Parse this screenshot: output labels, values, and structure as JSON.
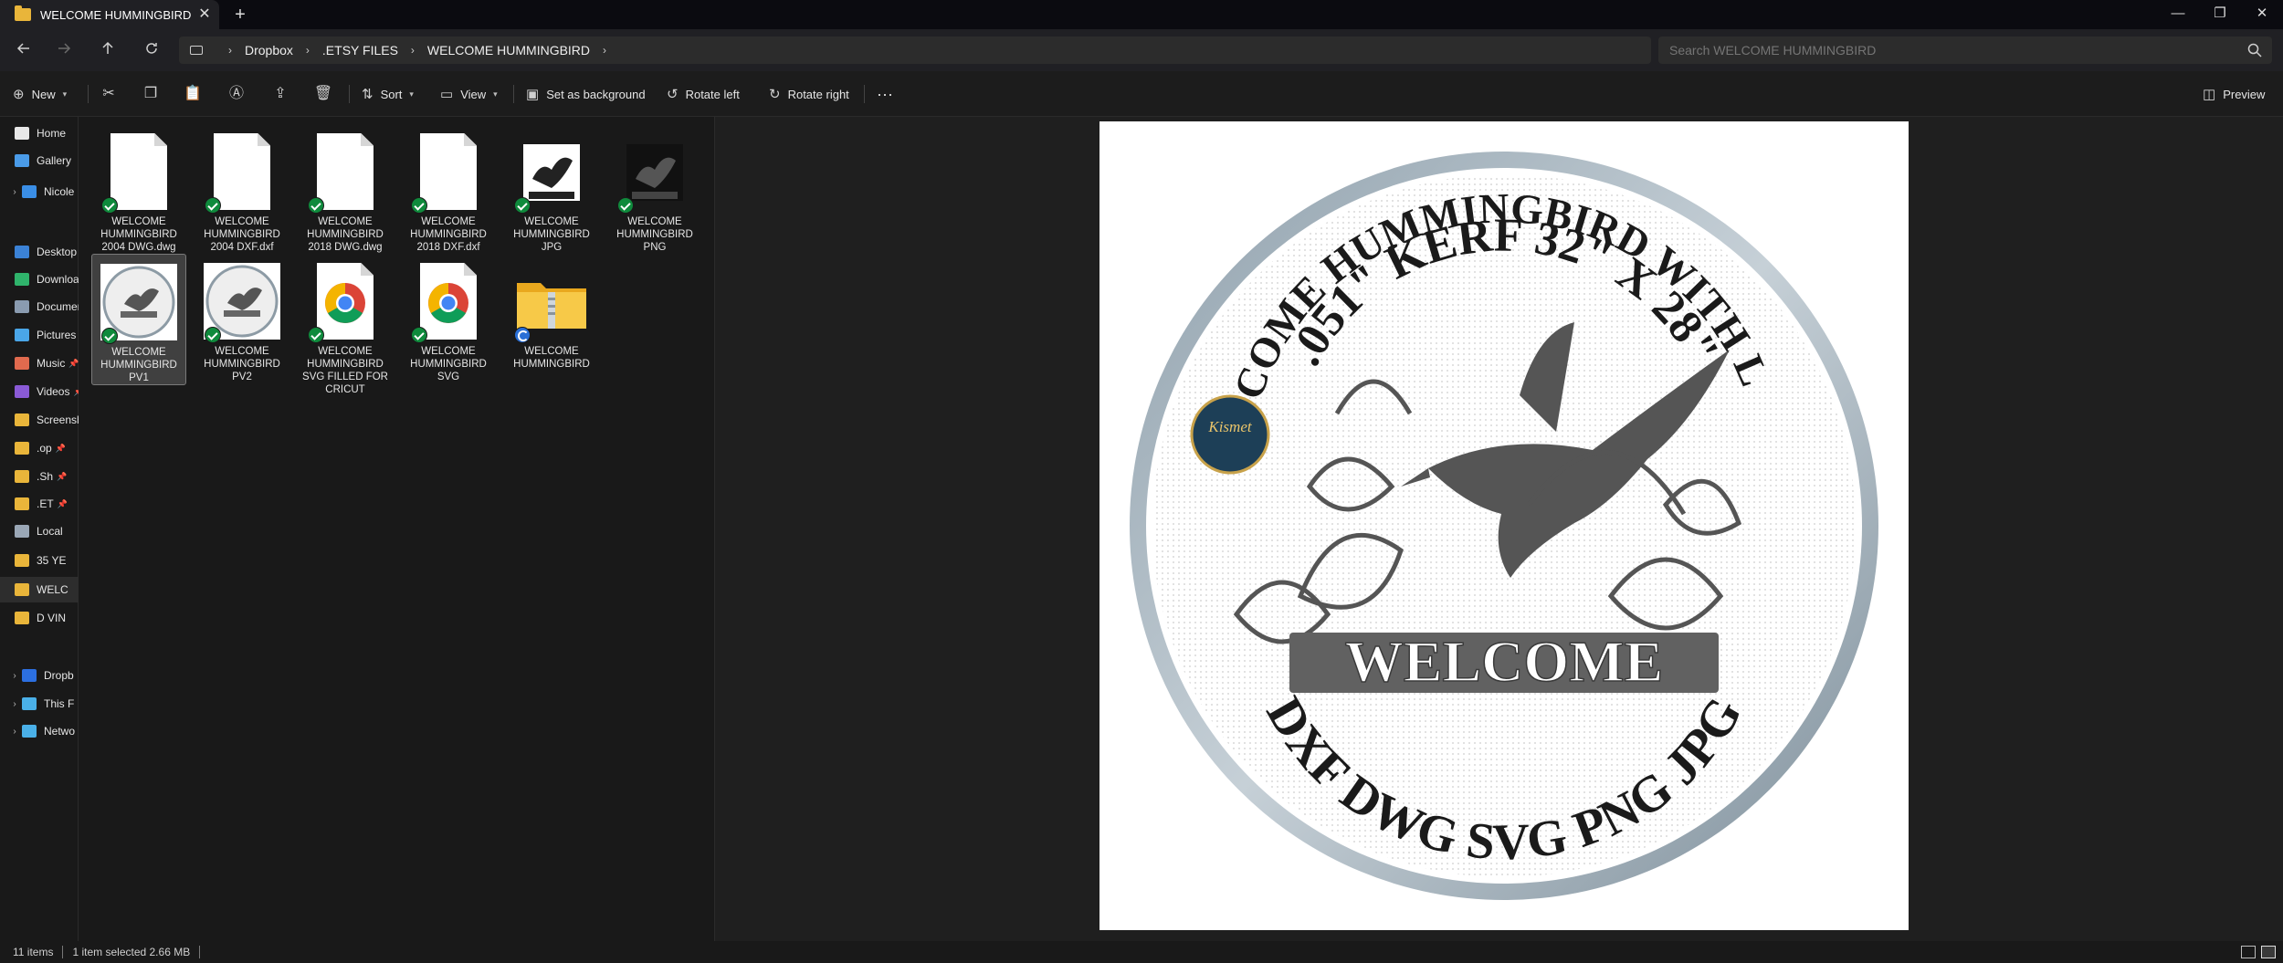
{
  "window": {
    "tab_title": "WELCOME HUMMINGBIRD",
    "new_tab_label": "+",
    "close_tab_label": "✕",
    "minimize_label": "—",
    "maximize_label": "❐",
    "close_label": "✕"
  },
  "address": {
    "breadcrumb": [
      "Dropbox",
      ".ETSY FILES",
      "WELCOME HUMMINGBIRD"
    ],
    "search_placeholder": "Search WELCOME HUMMINGBIRD"
  },
  "toolbar": {
    "new_label": "New",
    "sort_label": "Sort",
    "view_label": "View",
    "set_background_label": "Set as background",
    "rotate_left_label": "Rotate left",
    "rotate_right_label": "Rotate right",
    "more_label": "···",
    "preview_label": "Preview"
  },
  "sidebar": {
    "items": [
      {
        "label": "Home",
        "icon": "home-icon",
        "color": "#e8e8e8"
      },
      {
        "label": "Gallery",
        "icon": "gallery-icon",
        "color": "#4a9be8"
      },
      {
        "label": "Nicole",
        "icon": "onedrive-icon",
        "color": "#3a8ee6"
      },
      {
        "label": "Desktop",
        "icon": "desktop-icon",
        "color": "#3b82d6"
      },
      {
        "label": "Downloads",
        "icon": "download-icon",
        "color": "#2fb36b"
      },
      {
        "label": "Documents",
        "icon": "documents-icon",
        "color": "#8a9bb0"
      },
      {
        "label": "Pictures",
        "icon": "pictures-icon",
        "color": "#4aa6e8"
      },
      {
        "label": "Music",
        "icon": "music-icon",
        "color": "#e06a4e"
      },
      {
        "label": "Videos",
        "icon": "videos-icon",
        "color": "#8a5ad6"
      },
      {
        "label": "Screenshots",
        "icon": "folder-icon",
        "color": "#e9b53a"
      },
      {
        "label": ".op",
        "icon": "folder-icon",
        "color": "#e9b53a"
      },
      {
        "label": ".Sh",
        "icon": "folder-icon",
        "color": "#e9b53a"
      },
      {
        "label": ".ET",
        "icon": "folder-icon",
        "color": "#e9b53a"
      },
      {
        "label": "Local",
        "icon": "drive-icon",
        "color": "#9aa7b6"
      },
      {
        "label": "35 YE",
        "icon": "folder-icon",
        "color": "#e9b53a"
      },
      {
        "label": "WELC",
        "icon": "folder-icon",
        "color": "#e9b53a"
      },
      {
        "label": "D VIN",
        "icon": "folder-icon",
        "color": "#e9b53a"
      },
      {
        "label": "Dropb",
        "icon": "dropbox-icon",
        "color": "#2c6fe0"
      },
      {
        "label": "This F",
        "icon": "pc-icon",
        "color": "#4ab0e8"
      },
      {
        "label": "Netwo",
        "icon": "network-icon",
        "color": "#4ab0e8"
      }
    ]
  },
  "files": [
    {
      "name": "WELCOME HUMMINGBIRD 2004 DWG.dwg",
      "kind": "doc",
      "status": "synced"
    },
    {
      "name": "WELCOME HUMMINGBIRD 2004 DXF.dxf",
      "kind": "doc",
      "status": "synced"
    },
    {
      "name": "WELCOME HUMMINGBIRD 2018 DWG.dwg",
      "kind": "doc",
      "status": "synced"
    },
    {
      "name": "WELCOME HUMMINGBIRD 2018 DXF.dxf",
      "kind": "doc",
      "status": "synced"
    },
    {
      "name": "WELCOME HUMMINGBIRD JPG",
      "kind": "image-white",
      "status": "synced"
    },
    {
      "name": "WELCOME HUMMINGBIRD PNG",
      "kind": "image-dark",
      "status": "synced"
    },
    {
      "name": "WELCOME HUMMINGBIRD PV1",
      "kind": "image-round",
      "status": "synced"
    },
    {
      "name": "WELCOME HUMMINGBIRD PV2",
      "kind": "image-round2",
      "status": "synced"
    },
    {
      "name": "WELCOME HUMMINGBIRD SVG FILLED FOR CRICUT",
      "kind": "chrome",
      "status": "synced"
    },
    {
      "name": "WELCOME HUMMINGBIRD SVG",
      "kind": "chrome",
      "status": "synced"
    },
    {
      "name": "WELCOME HUMMINGBIRD",
      "kind": "zip",
      "status": "syncing"
    }
  ],
  "preview": {
    "top_text_line1": "WELCOME HUMMINGBIRD WITH LILIES",
    "top_text_line2": ".051\" KERF 32\" X 28\"",
    "banner_text": "WELCOME",
    "bottom_text": "DXF DWG SVG PNG JPG",
    "logo_text": "Kismet"
  },
  "status": {
    "item_count": "11 items",
    "selection": "1 item selected  2.66 MB"
  }
}
